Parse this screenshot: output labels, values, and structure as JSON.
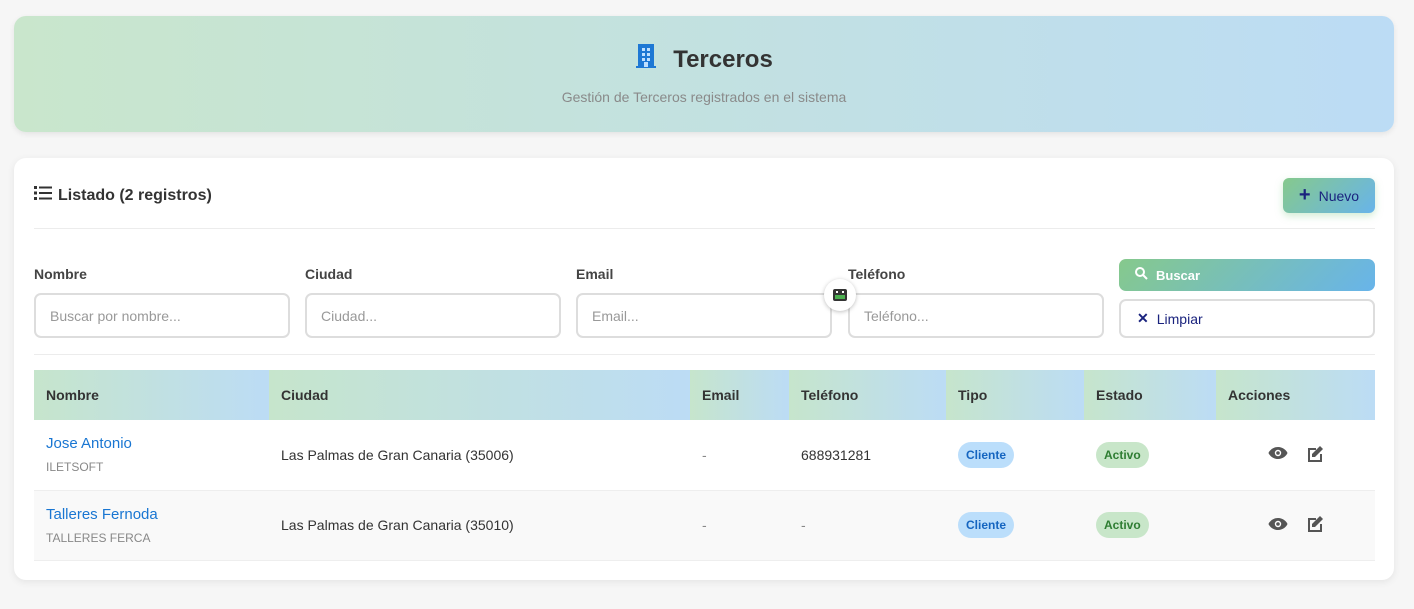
{
  "header": {
    "title": "Terceros",
    "subtitle": "Gestión de Terceros registrados en el sistema"
  },
  "listing": {
    "title": "Listado (2 registros)",
    "new_label": "Nuevo"
  },
  "filters": [
    {
      "label": "Nombre",
      "placeholder": "Buscar por nombre..."
    },
    {
      "label": "Ciudad",
      "placeholder": "Ciudad..."
    },
    {
      "label": "Email",
      "placeholder": "Email..."
    },
    {
      "label": "Teléfono",
      "placeholder": "Teléfono..."
    }
  ],
  "buttons": {
    "search": "Buscar",
    "clear": "Limpiar"
  },
  "table": {
    "headers": [
      "Nombre",
      "Ciudad",
      "Email",
      "Teléfono",
      "Tipo",
      "Estado",
      "Acciones"
    ],
    "rows": [
      {
        "name": "Jose Antonio",
        "company": "ILETSOFT",
        "city": "Las Palmas de Gran Canaria (35006)",
        "email": "-",
        "phone": "688931281",
        "type": "Cliente",
        "status": "Activo"
      },
      {
        "name": "Talleres Fernoda",
        "company": "TALLERES FERCA",
        "city": "Las Palmas de Gran Canaria (35010)",
        "email": "-",
        "phone": "-",
        "type": "Cliente",
        "status": "Activo"
      }
    ]
  },
  "colors": {
    "accent": "#1976d2",
    "green": "#86c98c",
    "blue": "#68b4ea"
  }
}
